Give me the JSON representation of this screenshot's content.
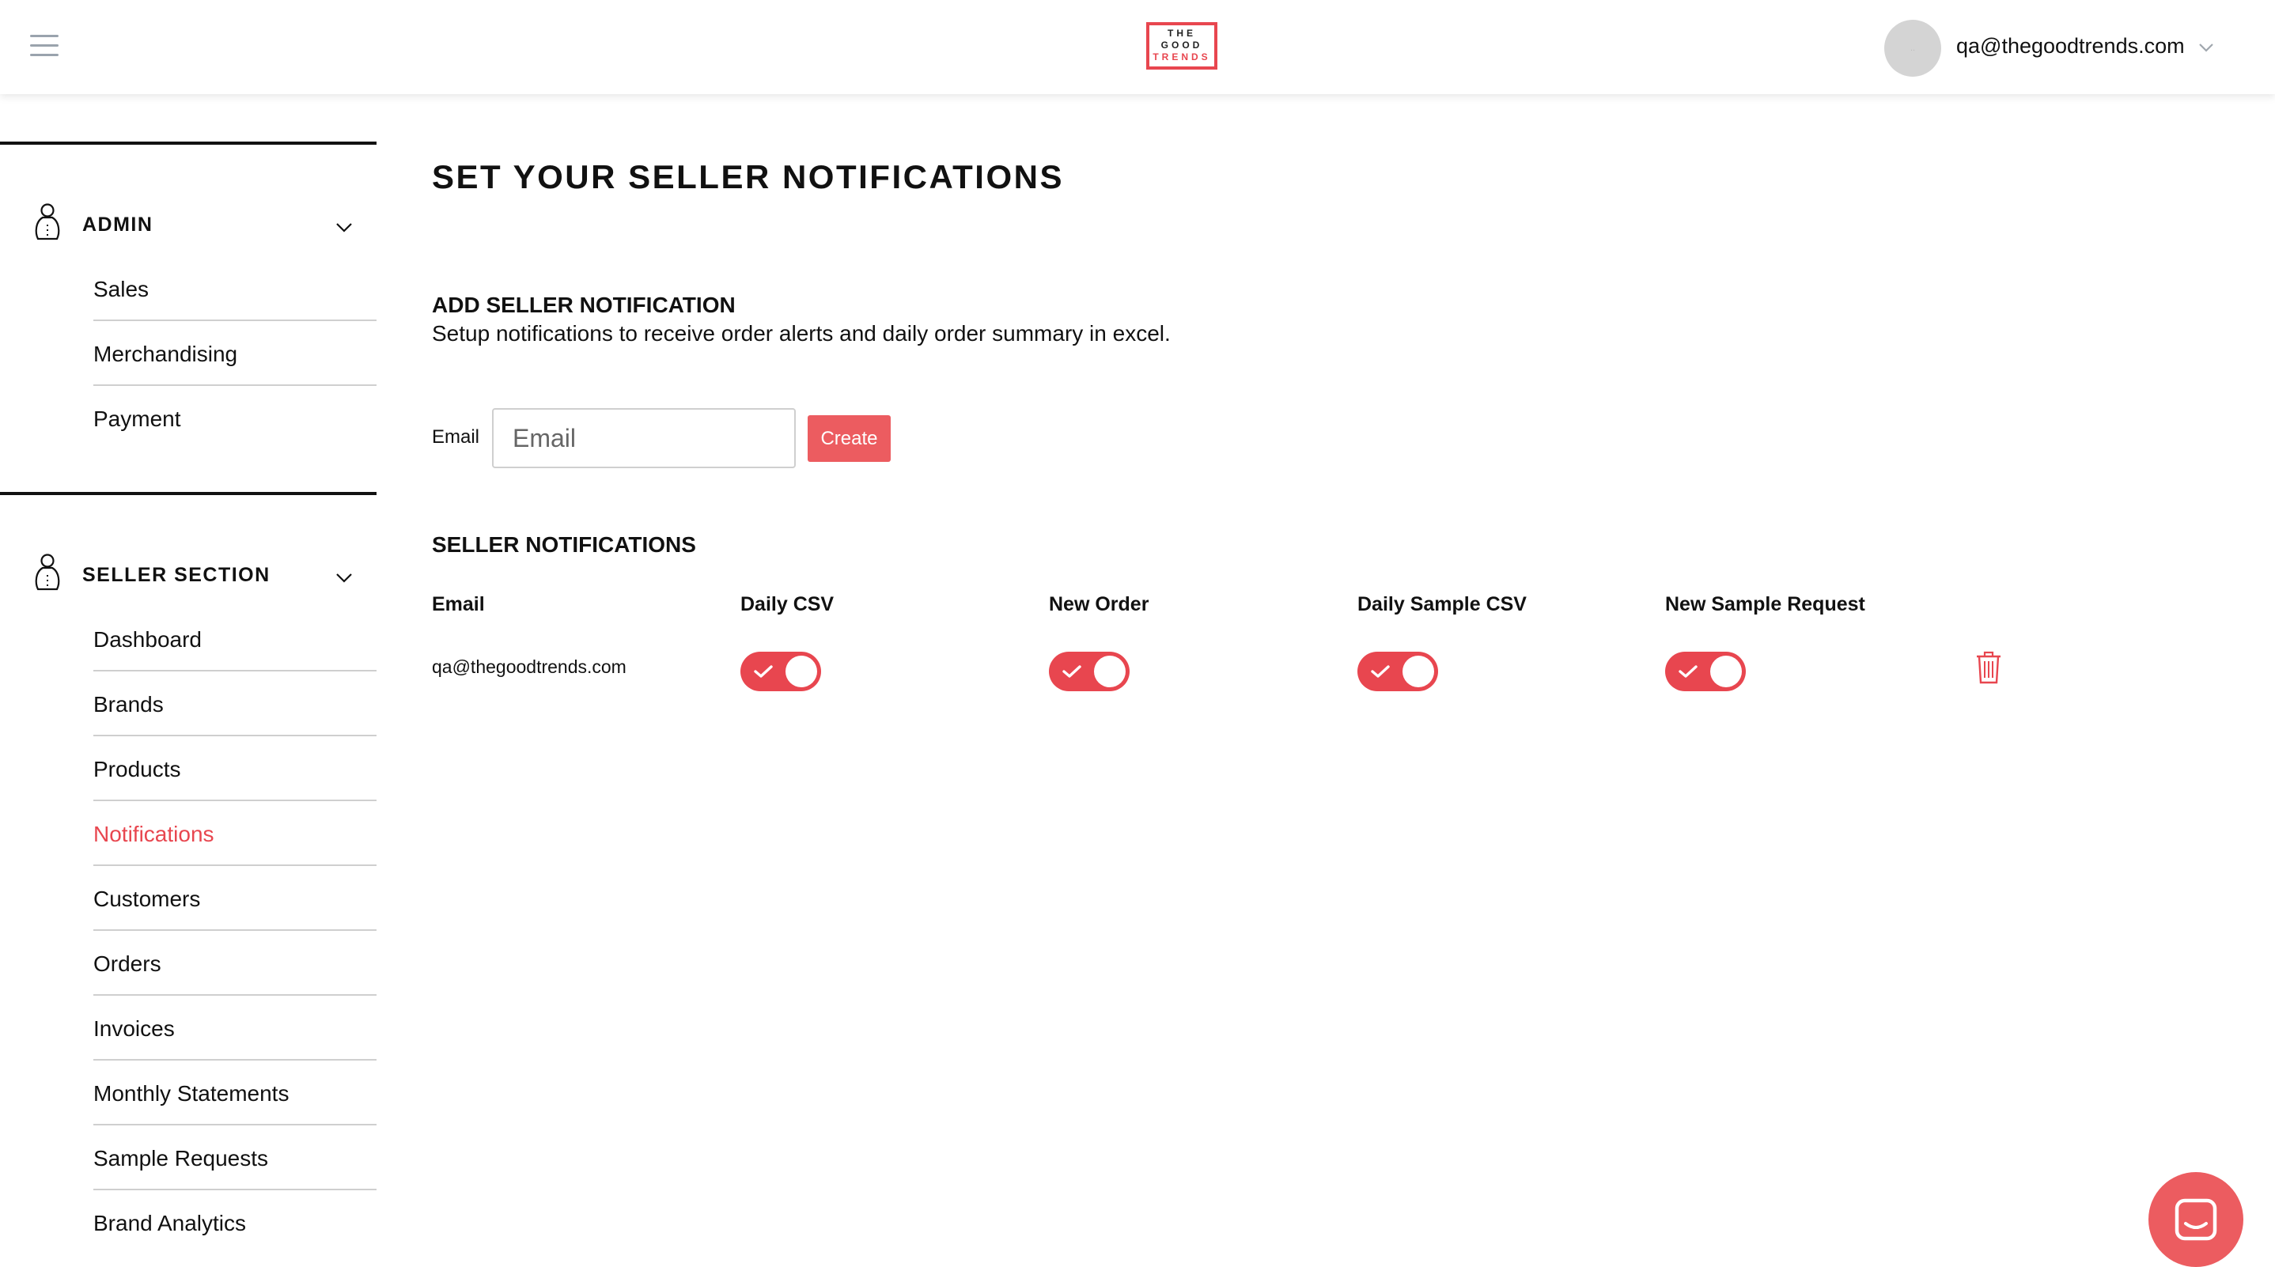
{
  "header": {
    "menu_icon": "hamburger-icon",
    "logo": {
      "line1": "THE",
      "line2": "GOOD",
      "line3": "TRENDS"
    },
    "avatar_text": "..",
    "user_email": "qa@thegoodtrends.com",
    "user_menu_icon": "chevron-down-icon"
  },
  "sidebar": {
    "sections": [
      {
        "title": "ADMIN",
        "icon": "user-icon",
        "items": [
          {
            "label": "Sales"
          },
          {
            "label": "Merchandising"
          },
          {
            "label": "Payment"
          }
        ]
      },
      {
        "title": "SELLER SECTION",
        "icon": "user-icon",
        "items": [
          {
            "label": "Dashboard"
          },
          {
            "label": "Brands"
          },
          {
            "label": "Products"
          },
          {
            "label": "Notifications",
            "active": true
          },
          {
            "label": "Customers"
          },
          {
            "label": "Orders"
          },
          {
            "label": "Invoices"
          },
          {
            "label": "Monthly Statements"
          },
          {
            "label": "Sample Requests"
          },
          {
            "label": "Brand Analytics"
          }
        ]
      }
    ]
  },
  "main": {
    "title": "SET YOUR SELLER NOTIFICATIONS",
    "add": {
      "heading": "ADD SELLER NOTIFICATION",
      "description": "Setup notifications to receive order alerts and daily order summary in excel.",
      "email_label": "Email",
      "email_placeholder": "Email",
      "email_value": "",
      "create_label": "Create"
    },
    "list": {
      "heading": "SELLER NOTIFICATIONS",
      "columns": [
        "Email",
        "Daily CSV",
        "New Order",
        "Daily Sample CSV",
        "New Sample Request"
      ],
      "rows": [
        {
          "email": "qa@thegoodtrends.com",
          "daily_csv": true,
          "new_order": true,
          "daily_sample_csv": true,
          "new_sample_request": true,
          "delete_icon": "trash-icon"
        }
      ]
    }
  },
  "chat_widget": {
    "icon": "chat-icon"
  },
  "colors": {
    "accent": "#e8464f",
    "button": "#ec5c60",
    "text": "#111111",
    "divider": "#cfcfcf"
  }
}
